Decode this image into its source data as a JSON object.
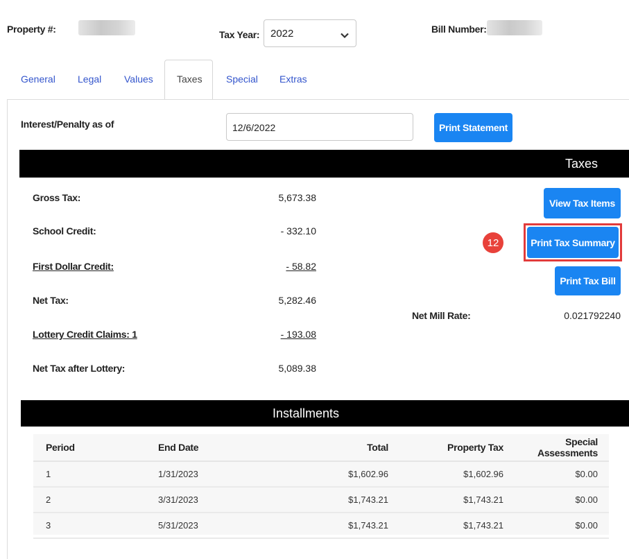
{
  "header": {
    "property_label": "Property #:",
    "tax_year_label": "Tax Year:",
    "tax_year_value": "2022",
    "bill_number_label": "Bill Number:"
  },
  "tabs": [
    {
      "label": "General",
      "active": false
    },
    {
      "label": "Legal",
      "active": false
    },
    {
      "label": "Values",
      "active": false
    },
    {
      "label": "Taxes",
      "active": true
    },
    {
      "label": "Special",
      "active": false
    },
    {
      "label": "Extras",
      "active": false
    }
  ],
  "interest": {
    "label": "Interest/Penalty as of",
    "date_value": "12/6/2022",
    "print_statement_label": "Print Statement"
  },
  "taxes": {
    "title": "Taxes",
    "rows": [
      {
        "label": "Gross Tax:",
        "value": "5,673.38",
        "link": false
      },
      {
        "label": "School Credit:",
        "value": "- 332.10",
        "link": false
      },
      {
        "label": "First Dollar Credit:",
        "value": "- 58.82",
        "link": true
      },
      {
        "label": "Net Tax:",
        "value": "5,282.46",
        "link": false
      },
      {
        "label": "Lottery Credit Claims: 1",
        "value": "- 193.08",
        "link": true
      },
      {
        "label": "Net Tax after Lottery:",
        "value": "5,089.38",
        "link": false
      }
    ],
    "view_tax_items_label": "View Tax Items",
    "print_tax_summary_label": "Print Tax Summary",
    "print_tax_bill_label": "Print Tax Bill",
    "net_mill_rate_label": "Net Mill Rate:",
    "net_mill_rate_value": "0.021792240",
    "step_badge": "12"
  },
  "installments": {
    "title": "Installments",
    "columns": [
      "Period",
      "End Date",
      "Total",
      "Property Tax",
      "Special Assessments"
    ],
    "rows": [
      [
        "1",
        "1/31/2023",
        "$1,602.96",
        "$1,602.96",
        "$0.00"
      ],
      [
        "2",
        "3/31/2023",
        "$1,743.21",
        "$1,743.21",
        "$0.00"
      ],
      [
        "3",
        "5/31/2023",
        "$1,743.21",
        "$1,743.21",
        "$0.00"
      ]
    ]
  },
  "colors": {
    "accent_button": "#1a85f2",
    "highlight_border": "#e23b3b",
    "tab_link": "#3355cc",
    "header_bar": "#000000"
  }
}
